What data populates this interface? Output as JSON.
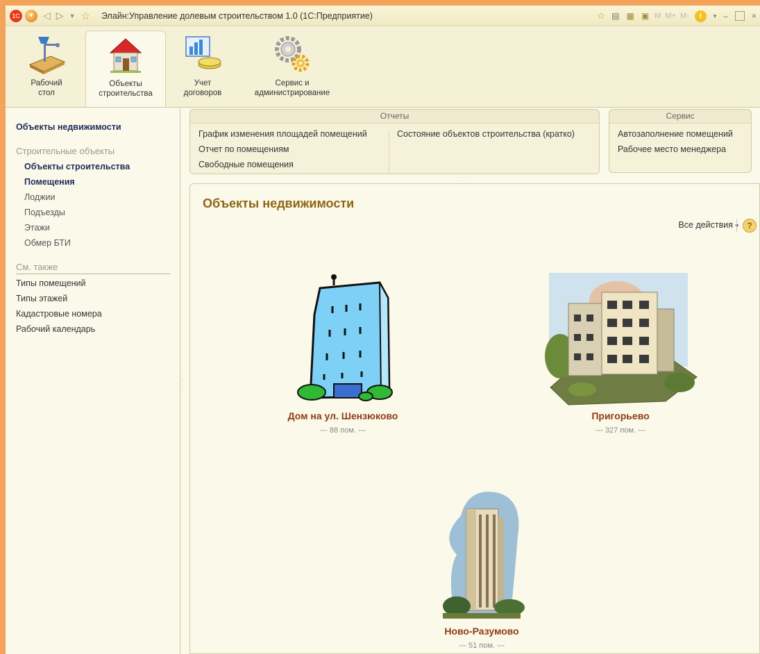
{
  "window": {
    "title": "Элайн:Управление долевым строительством 1.0  (1С:Предприятие)",
    "logo": "1С",
    "memory_buttons": [
      "M",
      "M+",
      "M-"
    ]
  },
  "sections": [
    {
      "id": "desktop",
      "label_1": "Рабочий",
      "label_2": "стол",
      "icon": "desk-lamp-icon"
    },
    {
      "id": "objects",
      "label_1": "Объекты",
      "label_2": "строительства",
      "icon": "house-icon",
      "active": true
    },
    {
      "id": "contracts",
      "label_1": "Учет",
      "label_2": "договоров",
      "icon": "chart-coins-icon"
    },
    {
      "id": "service",
      "label_1": "Сервис и",
      "label_2": "администрирование",
      "icon": "gears-icon"
    }
  ],
  "left_pane": {
    "title": "Объекты недвижимости",
    "group_title": "Строительные объекты",
    "items": [
      {
        "label": "Объекты строительства",
        "bold": true
      },
      {
        "label": "Помещения",
        "bold": true
      },
      {
        "label": "Лоджии"
      },
      {
        "label": "Подъезды"
      },
      {
        "label": "Этажи"
      },
      {
        "label": "Обмер БТИ"
      }
    ],
    "see_also_title": "См. также",
    "see_also": [
      "Типы помещений",
      "Типы этажей",
      "Кадастровые номера",
      "Рабочий календарь"
    ]
  },
  "reports": {
    "title": "Отчеты",
    "col1": [
      "График изменения площадей помещений",
      "Отчет по помещениям",
      "Свободные помещения"
    ],
    "col2": [
      "Состояние объектов строительства (кратко)"
    ]
  },
  "service": {
    "title": "Сервис",
    "links": [
      "Автозаполнение помещений",
      "Рабочее место менеджера"
    ]
  },
  "content": {
    "title": "Объекты недвижимости",
    "all_actions": "Все действия",
    "help": "?",
    "objects": [
      {
        "name": "Дом на ул. Шензюково",
        "count": "--- 88 пом. ---"
      },
      {
        "name": "Пригорьево",
        "count": "--- 327 пом. ---"
      },
      {
        "name": "Ново-Разумово",
        "count": "--- 51 пом. ---"
      }
    ]
  }
}
